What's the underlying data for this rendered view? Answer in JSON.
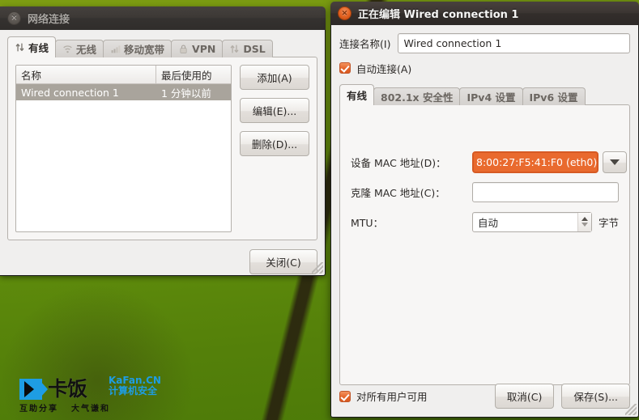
{
  "desktop": {
    "watermark": {
      "logo_char": "卡饭",
      "site": "KaFan.CN",
      "subtitle": "计算机安全",
      "slogan_left": "互助分享",
      "slogan_right": "大气谦和",
      "brand_color": "#1e9de3"
    }
  },
  "network_connections_window": {
    "title": "网络连接",
    "close_label": "×",
    "active": false,
    "tabs": [
      {
        "label": "有线",
        "icon": "wired-icon",
        "selected": true
      },
      {
        "label": "无线",
        "icon": "wireless-icon",
        "selected": false
      },
      {
        "label": "移动宽带",
        "icon": "mobile-broadband-icon",
        "selected": false
      },
      {
        "label": "VPN",
        "icon": "lock-icon",
        "selected": false
      },
      {
        "label": "DSL",
        "icon": "dsl-icon",
        "selected": false
      }
    ],
    "list": {
      "columns": [
        "名称",
        "最后使用的"
      ],
      "rows": [
        {
          "name": "Wired connection 1",
          "last_used": "1 分钟以前",
          "selected": true
        }
      ]
    },
    "side_buttons": [
      {
        "label": "添加(A)",
        "name": "add-button"
      },
      {
        "label": "编辑(E)...",
        "name": "edit-button"
      },
      {
        "label": "删除(D)...",
        "name": "delete-button"
      }
    ],
    "close_button_label": "关闭(C)"
  },
  "edit_connection_window": {
    "title": "正在编辑 Wired connection 1",
    "close_label": "×",
    "active": true,
    "connection_name_label": "连接名称(I)",
    "connection_name_value": "Wired connection 1",
    "autoconnect_label": "自动连接(A)",
    "autoconnect_checked": true,
    "tabs": [
      {
        "label": "有线",
        "selected": true
      },
      {
        "label": "802.1x 安全性",
        "selected": false
      },
      {
        "label": "IPv4 设置",
        "selected": false
      },
      {
        "label": "IPv6 设置",
        "selected": false
      }
    ],
    "fields": {
      "device_mac_label": "设备 MAC 地址(D)：",
      "device_mac_value": "8:00:27:F5:41:F0 (eth0)",
      "device_mac_highlight_color": "#e96a2e",
      "cloned_mac_label": "克隆 MAC 地址(C)：",
      "cloned_mac_value": "",
      "mtu_label": "MTU：",
      "mtu_value": "自动",
      "mtu_unit": "字节"
    },
    "available_all_users_label": "对所有用户可用",
    "available_all_users_checked": true,
    "cancel_label": "取消(C)",
    "save_label": "保存(S)..."
  }
}
